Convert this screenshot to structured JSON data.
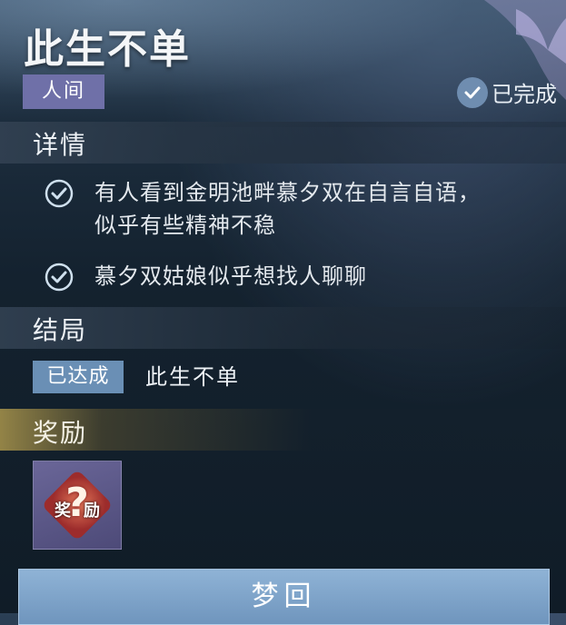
{
  "quest": {
    "title": "此生不单",
    "category": "人间",
    "status": "已完成"
  },
  "details": {
    "heading": "详情",
    "items": [
      {
        "line1": "有人看到金明池畔慕夕双在自言自语，",
        "line2": "似乎有些精神不稳"
      },
      {
        "line1": "慕夕双姑娘似乎想找人聊聊",
        "line2": ""
      }
    ]
  },
  "ending": {
    "heading": "结局",
    "badge": "已达成",
    "text": "此生不单"
  },
  "reward": {
    "heading": "奖励",
    "item_label": "奖励",
    "item_mark": "?"
  },
  "button": {
    "label": "梦回"
  },
  "colors": {
    "category_tag": "#6f70a8",
    "badge": "#6a8fb5",
    "button": "#7ea4c9",
    "reward_glow": "#bea550"
  }
}
